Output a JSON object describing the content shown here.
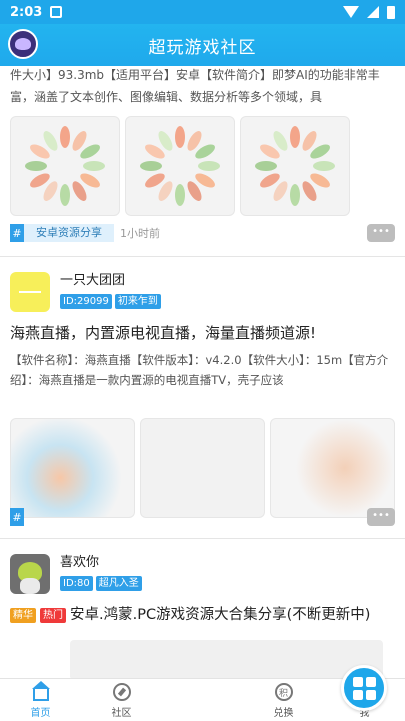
{
  "status": {
    "time": "2:03"
  },
  "header": {
    "title": "超玩游戏社区"
  },
  "post1": {
    "desc": "件大小】93.3mb【适用平台】安卓【软件简介】即梦AI的功能非常丰富，涵盖了文本创作、图像编辑、数据分析等多个领域，具",
    "tag": "安卓资源分享",
    "time_ago": "1小时前"
  },
  "post2": {
    "user": "一只大团团",
    "id": "ID:29099",
    "level": "初来乍到",
    "title": "海燕直播，内置源电视直播，海量直播频道源!",
    "desc": "【软件名称】：海燕直播【软件版本】：v4.2.0【软件大小】：15m【官方介绍】：海燕直播是一款内置源的电视直播TV，壳子应该"
  },
  "post3": {
    "user": "喜欢你",
    "id": "ID:80",
    "level": "超凡入圣",
    "label1": "精华",
    "label2": "热门",
    "title": "安卓.鸿蒙.PC游戏资源大合集分享(不断更新中)"
  },
  "tabs": [
    {
      "label": "首页",
      "icon": "home-icon"
    },
    {
      "label": "社区",
      "icon": "compass-icon"
    },
    {
      "label": "",
      "icon": "grid-icon"
    },
    {
      "label": "兑换",
      "icon": "points-icon"
    },
    {
      "label": "我",
      "icon": "profile-icon"
    }
  ],
  "icons": {
    "points_glyph": "积"
  },
  "colors": {
    "accent": "#1fa7ea",
    "hot": "#ef3a3a",
    "essence": "#f0a020"
  }
}
